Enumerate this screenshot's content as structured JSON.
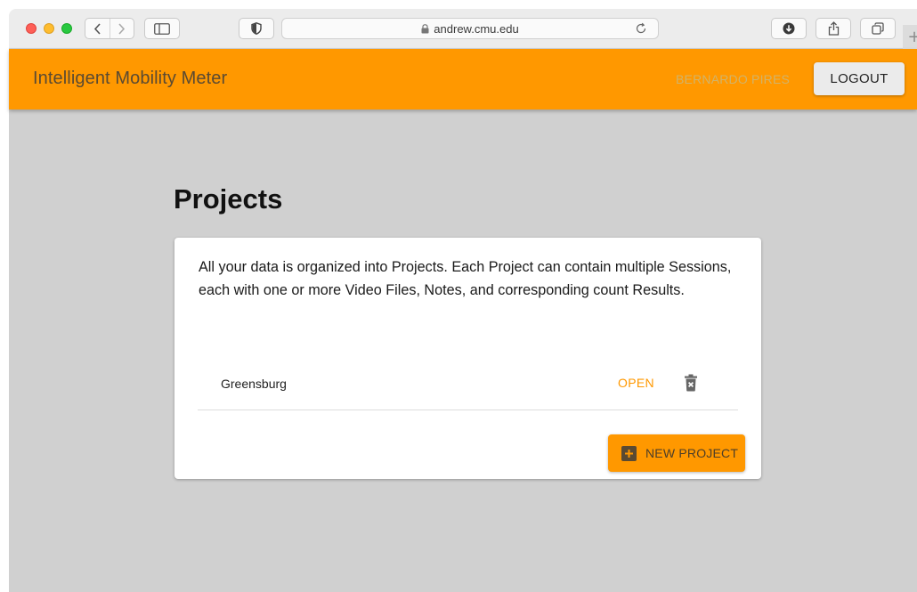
{
  "browser": {
    "url": "andrew.cmu.edu",
    "new_tab_symbol": "+"
  },
  "header": {
    "app_title": "Intelligent Mobility Meter",
    "user_name": "BERNARDO PIRES",
    "logout_label": "LOGOUT"
  },
  "main": {
    "page_title": "Projects",
    "description": "All your data is organized into Projects. Each Project can contain multiple Sessions, each with one or more Video Files, Notes, and corresponding count Results.",
    "projects": [
      {
        "name": "Greensburg",
        "open_label": "OPEN"
      }
    ],
    "new_project_label": "NEW PROJECT"
  },
  "colors": {
    "accent": "#ff9800",
    "app_background": "#d0d0d0",
    "card_background": "#ffffff"
  },
  "icons": {
    "lock": "lock-icon",
    "reload": "reload-icon",
    "delete": "delete-icon",
    "add": "plus-icon"
  }
}
